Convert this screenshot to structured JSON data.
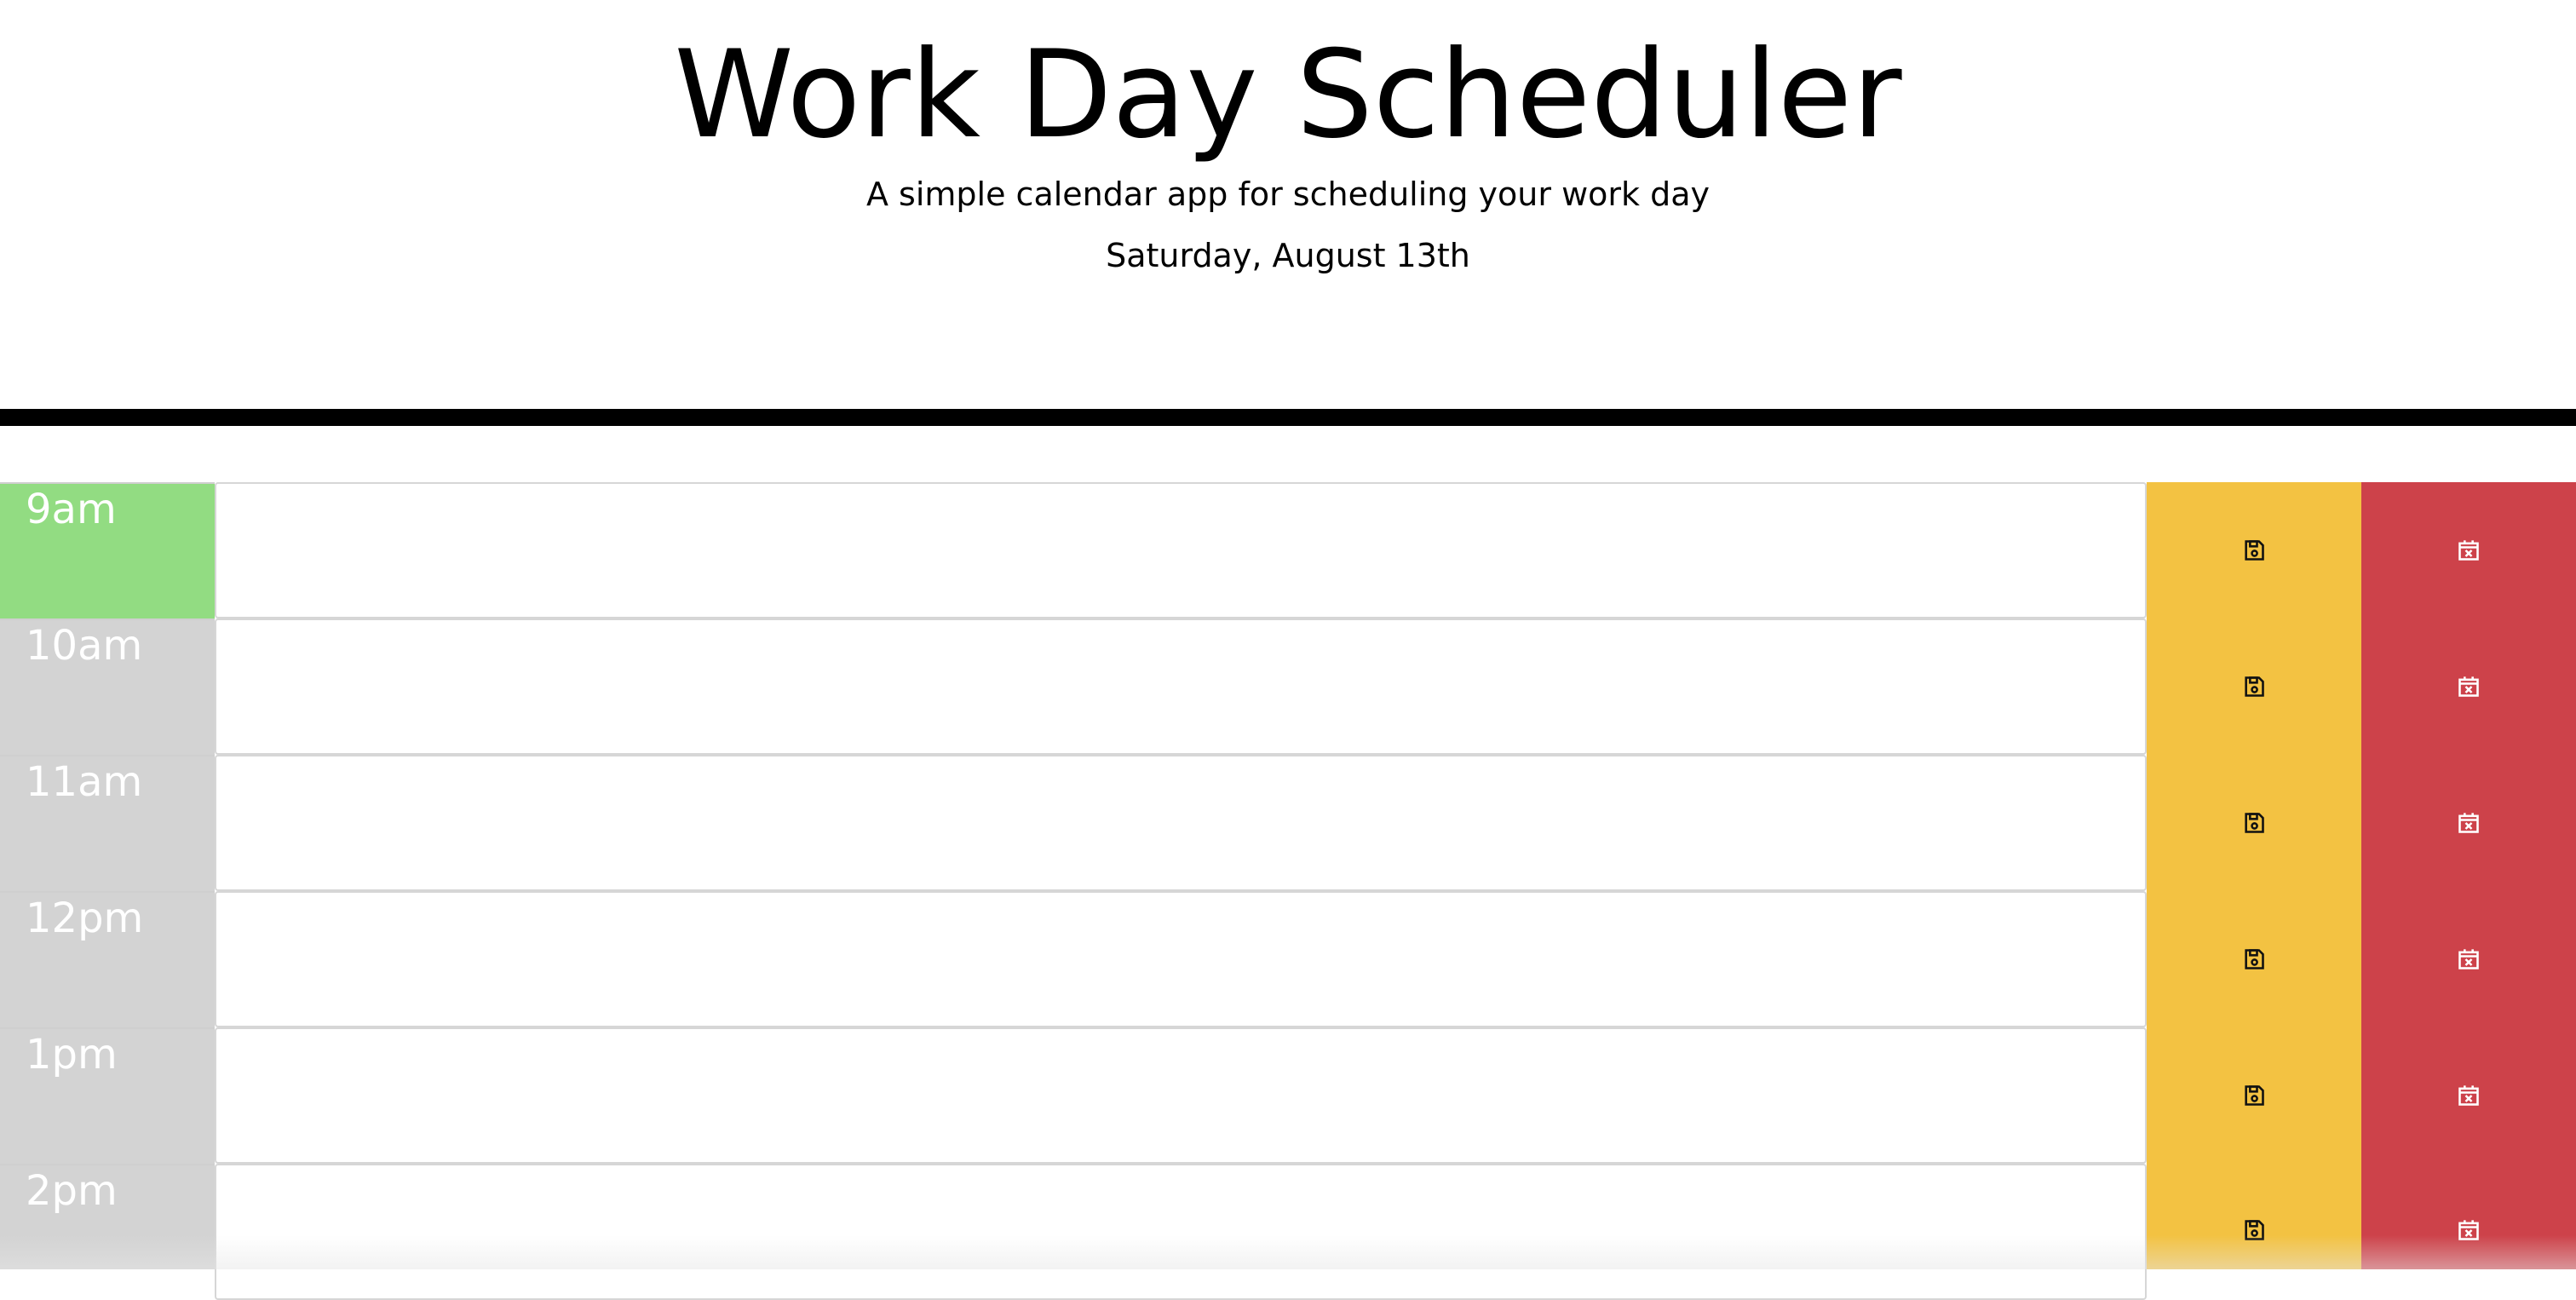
{
  "header": {
    "title": "Work Day Scheduler",
    "lead": "A simple calendar app for scheduling your work day",
    "current_day": "Saturday, August 13th"
  },
  "colors": {
    "present": "#92dc82",
    "past": "#d3d3d3",
    "save": "#f3c242",
    "clear": "#cd424a"
  },
  "timeblocks": [
    {
      "hour": "9am",
      "status": "present",
      "text": "",
      "save_icon": "floppy-disk-icon",
      "clear_icon": "calendar-x-icon"
    },
    {
      "hour": "10am",
      "status": "past",
      "text": "",
      "save_icon": "floppy-disk-icon",
      "clear_icon": "calendar-x-icon"
    },
    {
      "hour": "11am",
      "status": "past",
      "text": "",
      "save_icon": "floppy-disk-icon",
      "clear_icon": "calendar-x-icon"
    },
    {
      "hour": "12pm",
      "status": "past",
      "text": "",
      "save_icon": "floppy-disk-icon",
      "clear_icon": "calendar-x-icon"
    },
    {
      "hour": "1pm",
      "status": "past",
      "text": "",
      "save_icon": "floppy-disk-icon",
      "clear_icon": "calendar-x-icon"
    },
    {
      "hour": "2pm",
      "status": "past",
      "text": "",
      "save_icon": "floppy-disk-icon",
      "clear_icon": "calendar-x-icon"
    }
  ]
}
